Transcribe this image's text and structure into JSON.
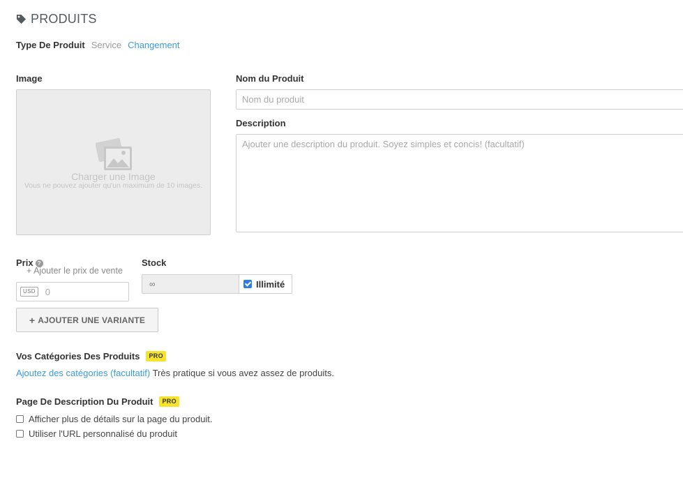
{
  "header": {
    "title": "PRODUITS",
    "icon": "tag-icon"
  },
  "product_type": {
    "label": "Type De Produit",
    "current": "Service",
    "change_link": "Changement"
  },
  "image": {
    "label": "Image",
    "upload_title": "Charger une Image",
    "upload_hint": "Vous ne pouvez ajouter qu'un maximum de 10 images.",
    "icon": "images-icon"
  },
  "name": {
    "label": "Nom du Produit",
    "placeholder": "Nom du produit"
  },
  "description": {
    "label": "Description",
    "placeholder": "Ajouter une description du produit. Soyez simples et concis! (facultatif)"
  },
  "price": {
    "label": "Prix",
    "help_icon": "question-circle-icon",
    "help_glyph": "?",
    "sale_price_link": "+ Ajouter le prix de vente",
    "currency": "USD",
    "placeholder": "0"
  },
  "stock": {
    "label": "Stock",
    "value": "∞",
    "unlimited_label": "Illimité",
    "unlimited_checked": true
  },
  "variant": {
    "plus": "+",
    "button_label": "AJOUTER UNE VARIANTE"
  },
  "categories": {
    "title": "Vos Catégories Des Produits",
    "badge": "PRO",
    "link": "Ajoutez des catégories (facultatif)",
    "hint": " Très pratique si vous avez assez de produits."
  },
  "product_page": {
    "title": "Page De Description Du Produit",
    "badge": "PRO",
    "options": [
      {
        "label": "Afficher plus de détails sur la page du produit.",
        "checked": false
      },
      {
        "label": "Utiliser l'URL personnalisé du produit",
        "checked": false
      }
    ]
  },
  "colors": {
    "accent": "#3a9bd9",
    "pro_badge": "#f6e32c",
    "checkbox": "#2a7de1"
  }
}
